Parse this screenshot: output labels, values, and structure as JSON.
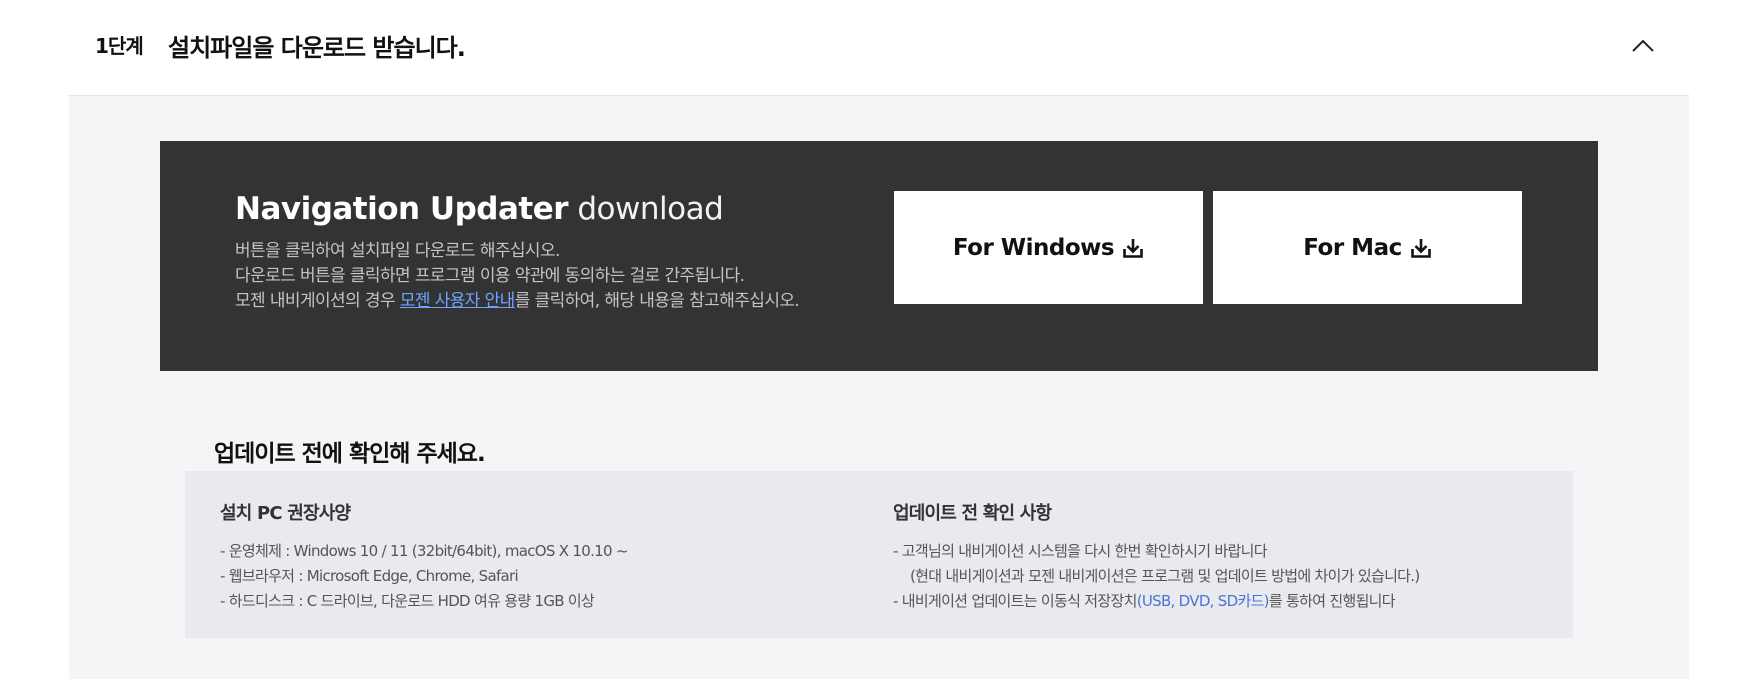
{
  "step": {
    "number": "1단계",
    "title": "설치파일을 다운로드 받습니다."
  },
  "banner": {
    "title_bold": "Navigation Updater",
    "title_light": "download",
    "line1": "버튼을 클릭하여 설치파일 다운로드 해주십시오.",
    "line2": "다운로드 버튼을 클릭하면 프로그램 이용 약관에 동의하는 걸로 간주됩니다.",
    "line3_prefix": "모젠 내비게이션의 경우 ",
    "line3_link": "모젠 사용자 안내",
    "line3_suffix": "를 클릭하여, 해당 내용을 참고해주십시오.",
    "windows_label": "For Windows",
    "mac_label": "For Mac"
  },
  "check": {
    "title": "업데이트 전에 확인해 주세요.",
    "left": {
      "title": "설치 PC 권장사양",
      "items": [
        "- 운영체제 : Windows 10 / 11 (32bit/64bit), macOS X 10.10 ~",
        "- 웹브라우저 : Microsoft Edge, Chrome, Safari",
        "- 하드디스크 : C 드라이브, 다운로드 HDD 여유 용량 1GB 이상"
      ]
    },
    "right": {
      "title": "업데이트 전 확인 사항",
      "item1": "- 고객님의 내비게이션 시스템을 다시 한번 확인하시기 바랍니다",
      "item2": "(현대 내비게이션과 모젠 내비게이션은 프로그램 및 업데이트 방법에 차이가 있습니다.)",
      "item3_prefix": "- 내비게이션 업데이트는 이동식 저장장치",
      "item3_highlight": "(USB, DVD, SD카드)",
      "item3_suffix": "를 통하여 진행됩니다"
    }
  },
  "colors": {
    "panel": "#333333",
    "link": "#6ea3ff",
    "highlight": "#4a74d9",
    "background": "#f4f5f7"
  },
  "icons": {
    "collapse": "chevron-up-icon",
    "download": "download-icon"
  }
}
